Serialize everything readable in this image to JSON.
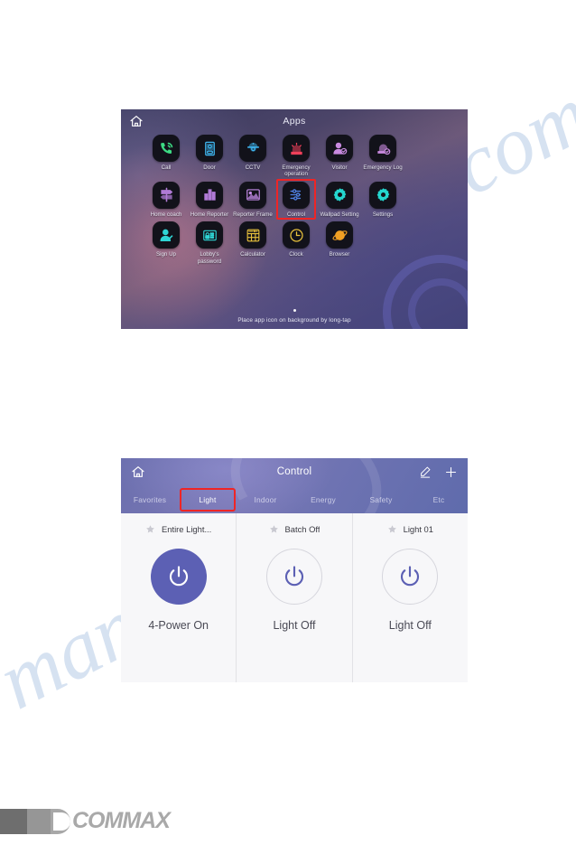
{
  "watermark": {
    "line1": "shive.com",
    "line2": "manualshive"
  },
  "apps_screen": {
    "title": "Apps",
    "home_icon": "home-icon",
    "hint": "Place app icon on background by long-tap",
    "page_dots": 1,
    "highlighted_app": "Control",
    "rows": [
      [
        {
          "label": "Call",
          "icon": "phone-icon",
          "color": "#3ddc84"
        },
        {
          "label": "Door",
          "icon": "door-station-icon",
          "color": "#3fb6f0"
        },
        {
          "label": "CCTV",
          "icon": "dome-camera-icon",
          "color": "#3fb6f0"
        },
        {
          "label": "Emergency\noperation",
          "icon": "siren-icon",
          "color": "#f0405a"
        },
        {
          "label": "Visitor",
          "icon": "visitor-icon",
          "color": "#c98ae0"
        },
        {
          "label": "Emergency\nLog",
          "icon": "emergency-log-icon",
          "color": "#c98ae0"
        }
      ],
      [
        {
          "label": "Home coach",
          "icon": "signpost-icon",
          "color": "#b07ad6"
        },
        {
          "label": "Home\nReporter",
          "icon": "bar-chart-icon",
          "color": "#b07ad6"
        },
        {
          "label": "Reporter\nFrame",
          "icon": "photo-frame-icon",
          "color": "#c38ae6"
        },
        {
          "label": "Control",
          "icon": "sliders-icon",
          "color": "#4f7fe0"
        },
        {
          "label": "Wallpad\nSetting",
          "icon": "gear-icon",
          "color": "#24d6cf"
        },
        {
          "label": "Settings",
          "icon": "gear-icon",
          "color": "#24d6cf"
        }
      ],
      [
        {
          "label": "Sign Up",
          "icon": "sign-up-icon",
          "color": "#2fd4d4"
        },
        {
          "label": "Lobby's\npassword",
          "icon": "keypad-lock-icon",
          "color": "#2fd4d4"
        },
        {
          "label": "Calculator",
          "icon": "calculator-icon",
          "color": "#e8c13c"
        },
        {
          "label": "Clock",
          "icon": "clock-icon",
          "color": "#e8c13c"
        },
        {
          "label": "Browser",
          "icon": "browser-planet-icon",
          "color": "#f0a024"
        }
      ]
    ]
  },
  "control_screen": {
    "title": "Control",
    "home_icon": "home-icon",
    "edit_icon": "pencil-icon",
    "add_icon": "plus-icon",
    "tabs": [
      {
        "label": "Favorites",
        "active": false
      },
      {
        "label": "Light",
        "active": true
      },
      {
        "label": "Indoor",
        "active": false
      },
      {
        "label": "Energy",
        "active": false
      },
      {
        "label": "Safety",
        "active": false
      },
      {
        "label": "Etc",
        "active": false
      }
    ],
    "highlighted_tab": "Light",
    "cards": [
      {
        "title": "Entire Light...",
        "status": "4-Power On",
        "power_on": true,
        "star": "star-icon"
      },
      {
        "title": "Batch Off",
        "status": "Light Off",
        "power_on": false,
        "star": "star-icon"
      },
      {
        "title": "Light 01",
        "status": "Light Off",
        "power_on": false,
        "star": "star-icon"
      }
    ]
  },
  "footer": {
    "brand": "COMMAX"
  },
  "colors": {
    "accent_red": "#ef2525",
    "power_on": "#5c60b4",
    "header_purple": "#6b6fae"
  }
}
